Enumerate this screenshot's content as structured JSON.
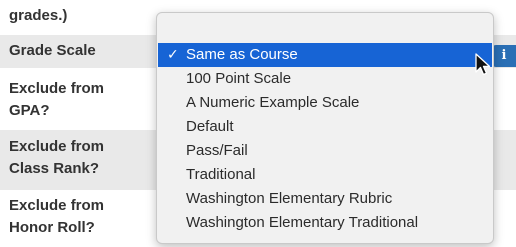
{
  "form": {
    "rows": [
      {
        "label_line1": "grades.)",
        "label_line2": ""
      },
      {
        "label_line1": "Grade Scale",
        "label_line2": ""
      },
      {
        "label_line1": "Exclude from",
        "label_line2": "GPA?"
      },
      {
        "label_line1": "Exclude from",
        "label_line2": "Class Rank?"
      },
      {
        "label_line1": "Exclude from",
        "label_line2": "Honor Roll?"
      }
    ],
    "info_icon": "info-icon"
  },
  "dropdown": {
    "selected_check": "✓",
    "options": [
      {
        "label": "Same as Course",
        "selected": true
      },
      {
        "label": "100 Point Scale",
        "selected": false
      },
      {
        "label": "A Numeric Example Scale",
        "selected": false
      },
      {
        "label": "Default",
        "selected": false
      },
      {
        "label": "Pass/Fail",
        "selected": false
      },
      {
        "label": "Traditional",
        "selected": false
      },
      {
        "label": "Washington Elementary Rubric",
        "selected": false
      },
      {
        "label": "Washington Elementary Traditional",
        "selected": false
      }
    ]
  },
  "colors": {
    "selected_bg": "#1764d5",
    "row_shade": "#e9e9e9",
    "info_icon_bg": "#2a6fb5"
  }
}
